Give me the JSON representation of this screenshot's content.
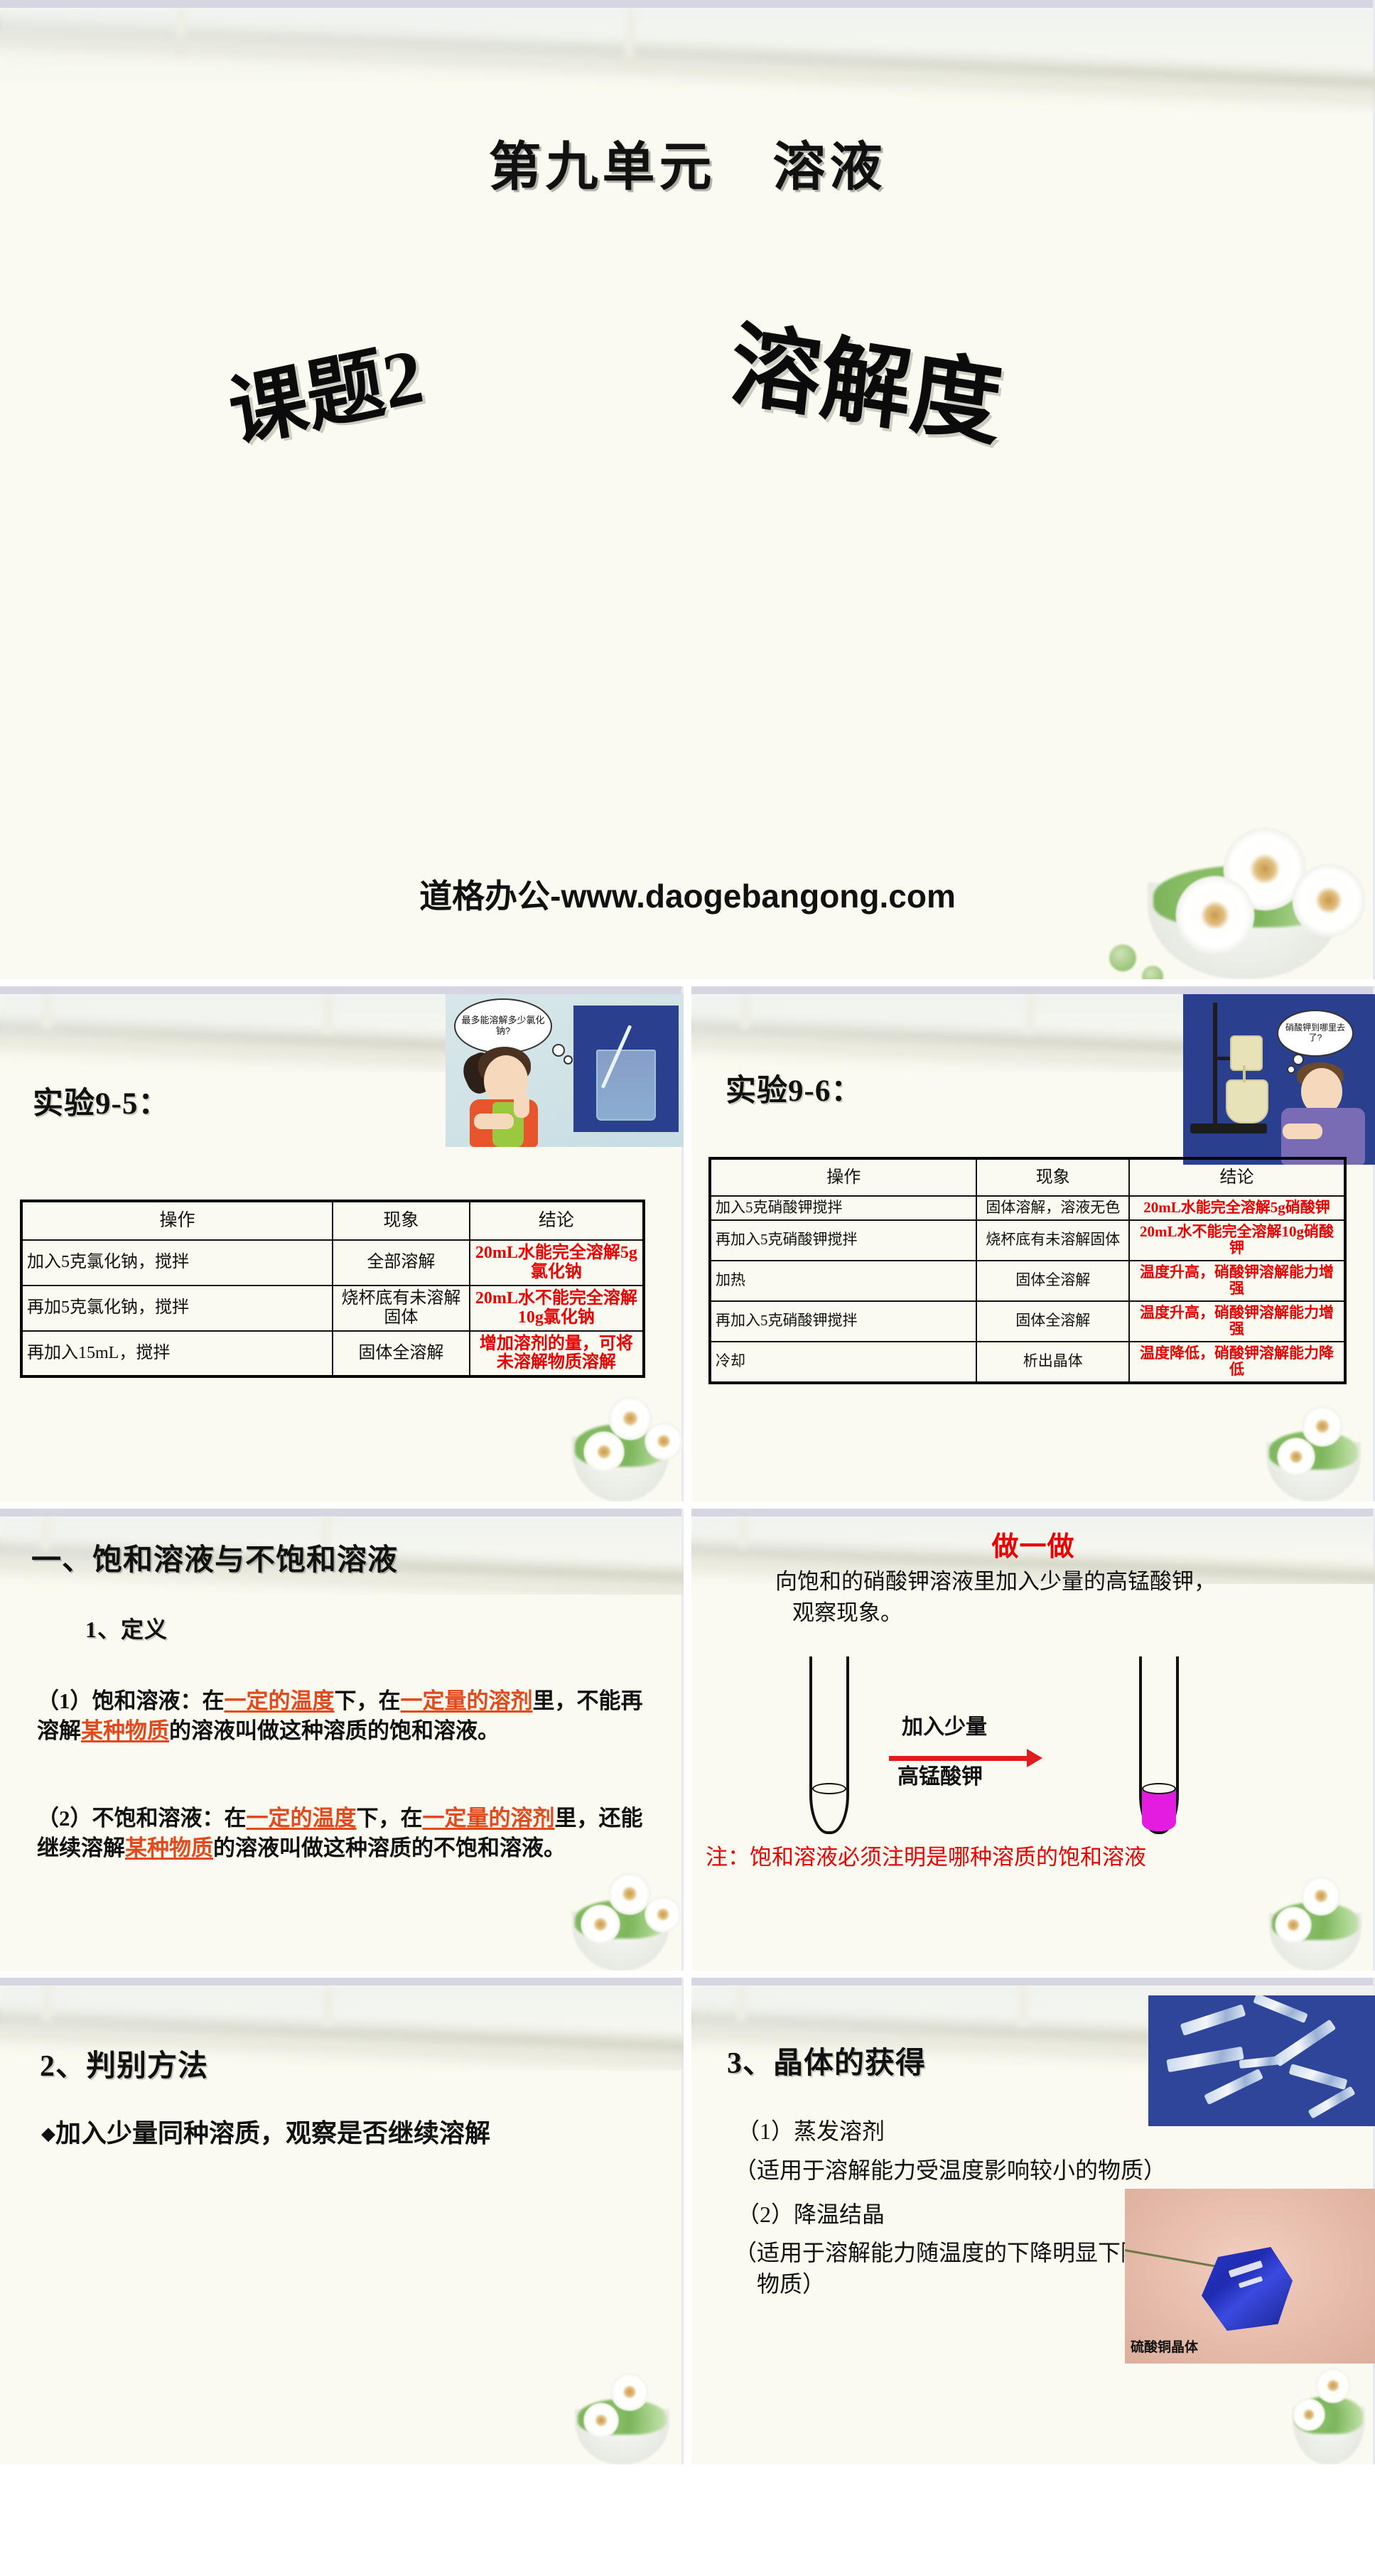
{
  "deck": {
    "slide1": {
      "unit_title": "第九单元　溶液",
      "wordart_left": "课题2",
      "wordart_right": "溶解度",
      "watermark": "道格办公-www.daogebangong.com"
    },
    "slide2": {
      "label": "实验9-5：",
      "thought_bubble": "最多能溶解多少氯化钠?",
      "table": {
        "headers": [
          "操作",
          "现象",
          "结论"
        ],
        "rows": [
          {
            "op": "加入5克氯化钠，搅拌",
            "phenomenon": "全部溶解",
            "conclusion": "20mL水能完全溶解5g氯化钠"
          },
          {
            "op": "再加5克氯化钠，搅拌",
            "phenomenon": "烧杯底有未溶解固体",
            "conclusion": "20mL水不能完全溶解10g氯化钠"
          },
          {
            "op": "再加入15mL，搅拌",
            "phenomenon": "固体全溶解",
            "conclusion": "增加溶剂的量，可将未溶解物质溶解"
          }
        ]
      }
    },
    "slide3": {
      "label": "实验9-6：",
      "thought_bubble": "硝酸钾到哪里去了?",
      "table": {
        "headers": [
          "操作",
          "现象",
          "结论"
        ],
        "rows": [
          {
            "op": "加入5克硝酸钾搅拌",
            "phenomenon": "固体溶解，溶液无色",
            "conclusion": "20mL水能完全溶解5g硝酸钾"
          },
          {
            "op": "再加入5克硝酸钾搅拌",
            "phenomenon": "烧杯底有未溶解固体",
            "conclusion": "20mL水不能完全溶解10g硝酸钾"
          },
          {
            "op": "加热",
            "phenomenon": "固体全溶解",
            "conclusion": "温度升高，硝酸钾溶解能力增强"
          },
          {
            "op": "再加入5克硝酸钾搅拌",
            "phenomenon": "固体全溶解",
            "conclusion": "温度升高，硝酸钾溶解能力增强"
          },
          {
            "op": "冷却",
            "phenomenon": "析出晶体",
            "conclusion": "温度降低，硝酸钾溶解能力降低"
          }
        ]
      }
    },
    "slide4": {
      "heading": "一、饱和溶液与不饱和溶液",
      "sub_heading": "1、定义",
      "def1": {
        "lead": "（1）饱和溶液：在",
        "hl1": "一定的温度",
        "mid1": "下，在",
        "hl2": "一定量的溶剂",
        "mid2": "里，不能再溶解",
        "hl3": "某种物质",
        "tail": "的溶液叫做这种溶质的饱和溶液。"
      },
      "def2": {
        "lead": "（2）不饱和溶液：在",
        "hl1": "一定的温度",
        "mid1": "下，在",
        "hl2": "一定量的溶剂",
        "mid2": "里，还能继续溶解",
        "hl3": "某种物质",
        "tail": "的溶液叫做这种溶质的不饱和溶液。"
      }
    },
    "slide5": {
      "heading": "做一做",
      "instruction_line1": "向饱和的硝酸钾溶液里加入少量的高锰酸钾，",
      "instruction_line2": "观察现象。",
      "arrow_label_top": "加入少量",
      "arrow_label_bottom": "高锰酸钾",
      "note": "注：饱和溶液必须注明是哪种溶质的饱和溶液",
      "liquid_color": "#e41ce0"
    },
    "slide6": {
      "heading": "2、判别方法",
      "bullet": "加入少量同种溶质，观察是否继续溶解"
    },
    "slide7": {
      "heading": "3、晶体的获得",
      "item1": "（1）蒸发溶剂",
      "item1_note": "（适用于溶解能力受温度影响较小的物质）",
      "item2": "（2）降温结晶",
      "item2_note_line1": "（适用于溶解能力随温度的下降明显下降的",
      "item2_note_line2": "　物质）",
      "photo_caption": "硫酸铜晶体"
    }
  },
  "colors": {
    "background": "#fafaf0",
    "accent_red": "#ea0000",
    "highlight_orange": "#e2491c",
    "band": "#d6d6e2"
  }
}
